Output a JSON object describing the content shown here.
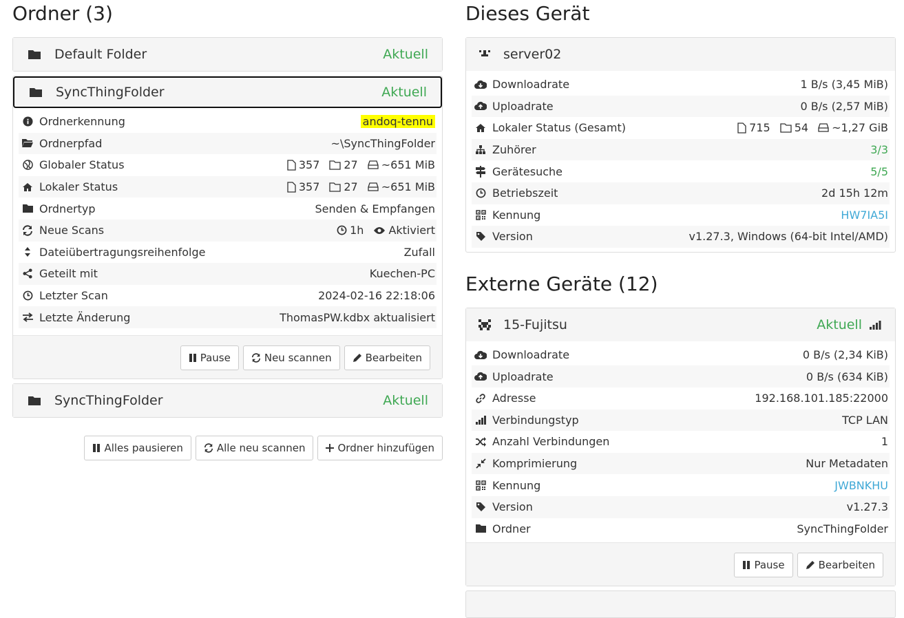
{
  "folders_section": {
    "title": "Ordner (3)",
    "folders": [
      {
        "name": "Default Folder",
        "status": "Aktuell"
      },
      {
        "name": "SyncThingFolder",
        "status": "Aktuell"
      },
      {
        "name": "SyncThingFolder",
        "status": "Aktuell"
      }
    ],
    "details": {
      "id_label": "Ordnerkennung",
      "id_value": "andoq-tennu",
      "path_label": "Ordnerpfad",
      "path_value": "~\\SyncThingFolder",
      "global_label": "Globaler Status",
      "global_files": "357",
      "global_dirs": "27",
      "global_size": "~651 MiB",
      "local_label": "Lokaler Status",
      "local_files": "357",
      "local_dirs": "27",
      "local_size": "~651 MiB",
      "type_label": "Ordnertyp",
      "type_value": "Senden & Empfangen",
      "scans_label": "Neue Scans",
      "scans_interval": "1h",
      "scans_watch": "Aktiviert",
      "order_label": "Dateiübertragungsreihenfolge",
      "order_value": "Zufall",
      "shared_label": "Geteilt mit",
      "shared_value": "Kuechen-PC",
      "lastscan_label": "Letzter Scan",
      "lastscan_value": "2024-02-16 22:18:06",
      "lastchange_label": "Letzte Änderung",
      "lastchange_value": "ThomasPW.kdbx aktualisiert"
    },
    "buttons": {
      "pause": "Pause",
      "rescan": "Neu scannen",
      "edit": "Bearbeiten"
    },
    "actions": {
      "pause_all": "Alles pausieren",
      "rescan_all": "Alle neu scannen",
      "add_folder": "Ordner hinzufügen"
    }
  },
  "this_device": {
    "title": "Dieses Gerät",
    "name": "server02",
    "download_label": "Downloadrate",
    "download_value": "1 B/s (3,45 MiB)",
    "upload_label": "Uploadrate",
    "upload_value": "0 B/s (2,57 MiB)",
    "local_label": "Lokaler Status (Gesamt)",
    "local_files": "715",
    "local_dirs": "54",
    "local_size": "~1,27 GiB",
    "listeners_label": "Zuhörer",
    "listeners_value": "3/3",
    "discovery_label": "Gerätesuche",
    "discovery_value": "5/5",
    "uptime_label": "Betriebszeit",
    "uptime_value": "2d 15h 12m",
    "id_label": "Kennung",
    "id_value": "HW7IA5I",
    "version_label": "Version",
    "version_value": "v1.27.3, Windows (64-bit Intel/AMD)"
  },
  "remote_devices": {
    "title": "Externe Geräte (12)",
    "device": {
      "name": "15-Fujitsu",
      "status": "Aktuell",
      "download_label": "Downloadrate",
      "download_value": "0 B/s (2,34 KiB)",
      "upload_label": "Uploadrate",
      "upload_value": "0 B/s (634 KiB)",
      "address_label": "Adresse",
      "address_value": "192.168.101.185:22000",
      "conntype_label": "Verbindungstyp",
      "conntype_value": "TCP LAN",
      "conncount_label": "Anzahl Verbindungen",
      "conncount_value": "1",
      "compression_label": "Komprimierung",
      "compression_value": "Nur Metadaten",
      "id_label": "Kennung",
      "id_value": "JWBNKHU",
      "version_label": "Version",
      "version_value": "v1.27.3",
      "folders_label": "Ordner",
      "folders_value": "SyncThingFolder"
    },
    "buttons": {
      "pause": "Pause",
      "edit": "Bearbeiten"
    }
  },
  "colors": {
    "status_green": "#3fa853",
    "link_blue": "#3fa8d6",
    "highlight": "#ffff00"
  }
}
